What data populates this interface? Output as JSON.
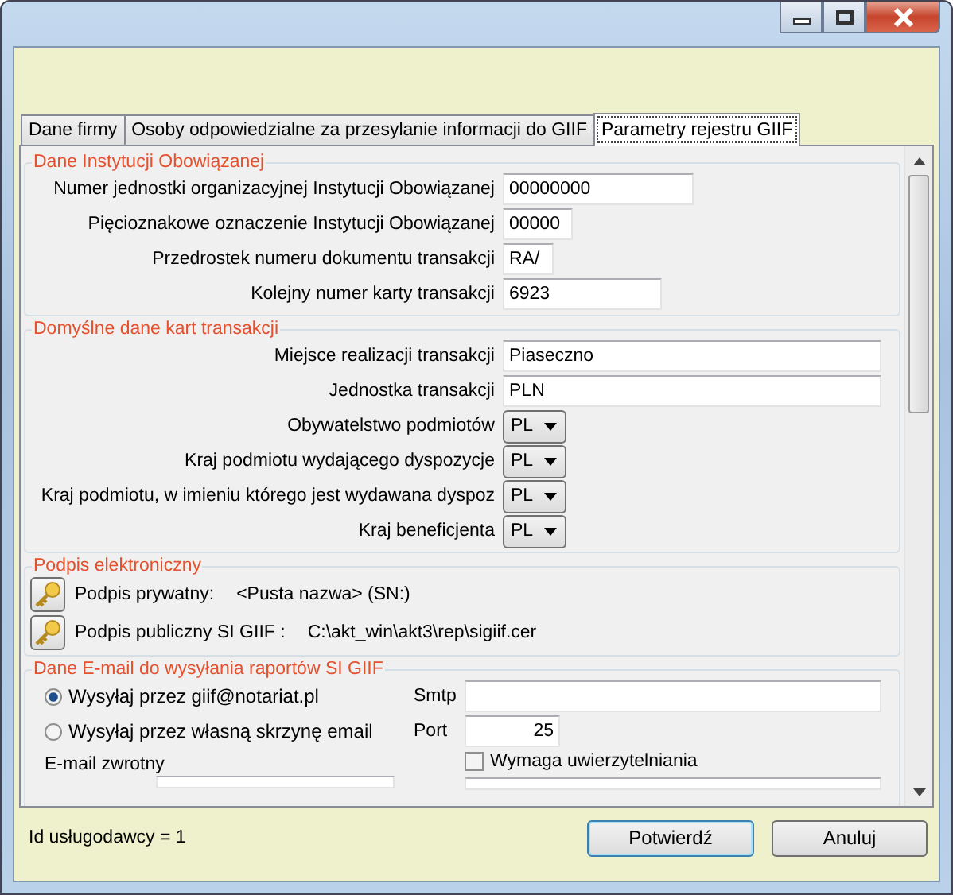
{
  "tabs": [
    {
      "label": "Dane firmy",
      "selected": false
    },
    {
      "label": "Osoby odpowiedzialne za przesylanie informacji do GIIF",
      "selected": false
    },
    {
      "label": "Parametry rejestru GIIF",
      "selected": true
    }
  ],
  "institution": {
    "legend": "Dane Instytucji Obowiązanej",
    "fields": [
      {
        "label": "Numer jednostki organizacyjnej Instytucji Obowiązanej",
        "value": "00000000"
      },
      {
        "label": "Pięcioznakowe oznaczenie Instytucji Obowiązanej",
        "value": "00000"
      },
      {
        "label": "Przedrostek numeru dokumentu transakcji",
        "value": "RA/"
      },
      {
        "label": "Kolejny numer karty transakcji",
        "value": "6923"
      }
    ]
  },
  "defaults": {
    "legend": "Domyślne dane kart transakcji",
    "fields": [
      {
        "kind": "text",
        "label": "Miejsce realizacji transakcji",
        "value": "Piaseczno"
      },
      {
        "kind": "text",
        "label": "Jednostka transakcji",
        "value": "PLN"
      },
      {
        "kind": "select",
        "label": "Obywatelstwo podmiotów",
        "value": "PL"
      },
      {
        "kind": "select",
        "label": "Kraj podmiotu wydającego dyspozycje",
        "value": "PL"
      },
      {
        "kind": "select",
        "label": "Kraj podmiotu, w imieniu którego jest wydawana dyspoz",
        "value": "PL"
      },
      {
        "kind": "select",
        "label": "Kraj beneficjenta",
        "value": "PL"
      }
    ]
  },
  "signature": {
    "legend": "Podpis elektroniczny",
    "rows": [
      {
        "label": "Podpis prywatny:",
        "value": "<Pusta nazwa> (SN:)"
      },
      {
        "label": "Podpis publiczny SI GIIF :",
        "value": "C:\\akt_win\\akt3\\rep\\sigiif.cer"
      }
    ]
  },
  "email": {
    "legend": "Dane E-mail do wysyłania raportów SI GIIF",
    "options": [
      {
        "label": "Wysyłaj przez giif@notariat.pl",
        "selected": true
      },
      {
        "label": "Wysyłaj przez własną skrzynę email",
        "selected": false
      }
    ],
    "smtp_label": "Smtp",
    "port_label": "Port",
    "port": "25",
    "auth": {
      "label": "Wymaga uwierzytelniania",
      "checked": false
    },
    "return_label": "E-mail zwrotny"
  },
  "footer": {
    "provider": "Id usługodawcy = 1",
    "buttons": [
      "Potwierdź",
      "Anuluj"
    ]
  }
}
